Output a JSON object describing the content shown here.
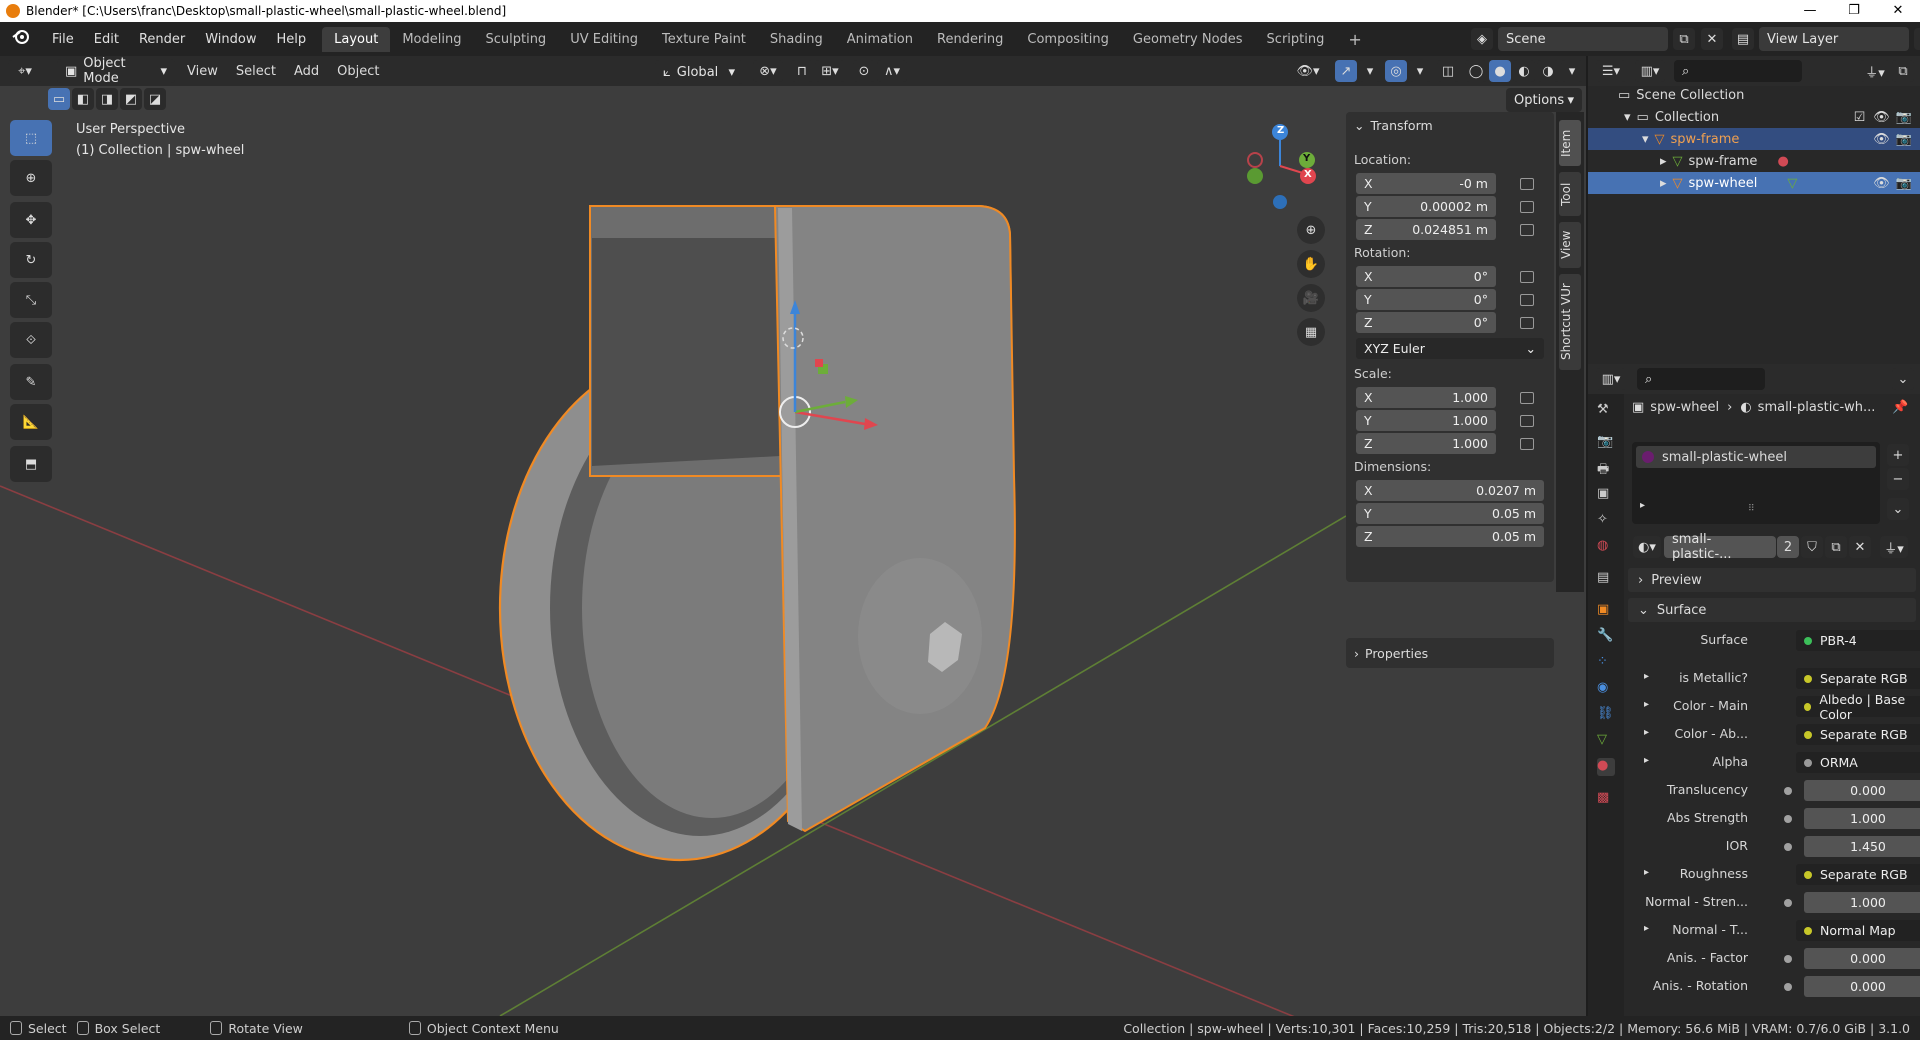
{
  "window": {
    "title": "Blender* [C:\\Users\\franc\\Desktop\\small-plastic-wheel\\small-plastic-wheel.blend]",
    "controls": [
      "—",
      "❐",
      "✕"
    ]
  },
  "menubar": {
    "items": [
      "File",
      "Edit",
      "Render",
      "Window",
      "Help"
    ]
  },
  "workspaces": {
    "tabs": [
      "Layout",
      "Modeling",
      "Sculpting",
      "UV Editing",
      "Texture Paint",
      "Shading",
      "Animation",
      "Rendering",
      "Compositing",
      "Geometry Nodes",
      "Scripting"
    ],
    "active": "Layout",
    "add": "+"
  },
  "scene": {
    "name": "Scene",
    "view_layer": "View Layer"
  },
  "viewport_header": {
    "mode": "Object Mode",
    "menus": [
      "View",
      "Select",
      "Add",
      "Object"
    ],
    "orientation": "Global",
    "options": "Options"
  },
  "viewport": {
    "perspective": "User Perspective",
    "collection_info": "(1) Collection | spw-wheel",
    "gizmo_axes": [
      "Z",
      "Y",
      "X"
    ]
  },
  "n_panel": {
    "section": "Transform",
    "location_label": "Location:",
    "location": [
      {
        "axis": "X",
        "value": "-0 m"
      },
      {
        "axis": "Y",
        "value": "0.00002 m"
      },
      {
        "axis": "Z",
        "value": "0.024851 m"
      }
    ],
    "rotation_label": "Rotation:",
    "rotation": [
      {
        "axis": "X",
        "value": "0°"
      },
      {
        "axis": "Y",
        "value": "0°"
      },
      {
        "axis": "Z",
        "value": "0°"
      }
    ],
    "rotation_mode": "XYZ Euler",
    "scale_label": "Scale:",
    "scale": [
      {
        "axis": "X",
        "value": "1.000"
      },
      {
        "axis": "Y",
        "value": "1.000"
      },
      {
        "axis": "Z",
        "value": "1.000"
      }
    ],
    "dimensions_label": "Dimensions:",
    "dimensions": [
      {
        "axis": "X",
        "value": "0.0207 m"
      },
      {
        "axis": "Y",
        "value": "0.05 m"
      },
      {
        "axis": "Z",
        "value": "0.05 m"
      }
    ],
    "properties": "Properties"
  },
  "side_tabs": [
    "Item",
    "Tool",
    "View",
    "Shortcut VUr"
  ],
  "outliner": {
    "rows": [
      {
        "label": "Scene Collection"
      },
      {
        "label": "Collection"
      },
      {
        "label": "spw-frame"
      },
      {
        "label": "spw-frame"
      },
      {
        "label": "spw-wheel"
      }
    ]
  },
  "properties": {
    "breadcrumb_object": "spw-wheel",
    "breadcrumb_material": "small-plastic-wh...",
    "material_slot": "small-plastic-wheel",
    "material_name": "small-plastic-...",
    "user_count": "2",
    "preview": "Preview",
    "surface_section": "Surface",
    "rows": [
      {
        "label": "Surface",
        "value": "PBR-4",
        "dot": "#3cbf5a"
      },
      {
        "label": "is Metallic?",
        "value": "Separate RGB",
        "dot": "#c7c729"
      },
      {
        "label": "Color - Main",
        "value": "Albedo | Base Color",
        "dot": "#c7c729"
      },
      {
        "label": "Color - Ab...",
        "value": "Separate RGB",
        "dot": "#c7c729"
      },
      {
        "label": "Alpha",
        "value": "ORMA",
        "dot": "#9a9a9a"
      },
      {
        "label": "Translucency",
        "value": "0.000",
        "dot": "#a1a1a1"
      },
      {
        "label": "Abs Strength",
        "value": "1.000",
        "dot": "#a1a1a1"
      },
      {
        "label": "IOR",
        "value": "1.450",
        "dot": "#a1a1a1"
      },
      {
        "label": "Roughness",
        "value": "Separate RGB",
        "dot": "#c7c729"
      },
      {
        "label": "Normal - Stren...",
        "value": "1.000",
        "dot": "#a1a1a1"
      },
      {
        "label": "Normal - T...",
        "value": "Normal Map",
        "dot": "#c7c729"
      },
      {
        "label": "Anis. - Factor",
        "value": "0.000",
        "dot": "#a1a1a1"
      },
      {
        "label": "Anis. - Rotation",
        "value": "0.000",
        "dot": "#a1a1a1"
      }
    ]
  },
  "statusbar": {
    "select": "Select",
    "box_select": "Box Select",
    "rotate_view": "Rotate View",
    "context_menu": "Object Context Menu",
    "stats": "Collection | spw-wheel | Verts:10,301 | Faces:10,259 | Tris:20,518 | Objects:2/2 | Memory: 56.6 MiB | VRAM: 0.7/6.0 GiB | 3.1.0"
  },
  "colors": {
    "accent": "#4772b3",
    "selection_outline": "#f08a24",
    "x_axis": "#e0464f",
    "y_axis": "#6dad3a",
    "z_axis": "#3c85d9"
  }
}
